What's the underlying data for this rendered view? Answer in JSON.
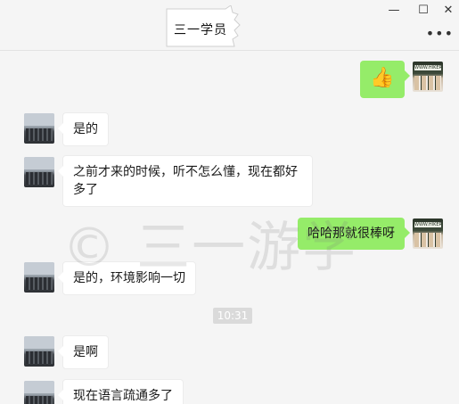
{
  "header": {
    "title": "三一学员",
    "minimize_glyph": "—",
    "maximize_glyph": "☐",
    "close_glyph": "✕",
    "more_glyph": "•••"
  },
  "messages": [
    {
      "side": "right",
      "type": "emoji",
      "icon": "thumbs-up",
      "text": "👍"
    },
    {
      "side": "left",
      "text": "是的"
    },
    {
      "side": "left",
      "text": "之前才来的时候，听不怎么懂，现在都好多了"
    },
    {
      "side": "right",
      "text": "哈哈那就很棒呀"
    },
    {
      "side": "left",
      "text": "是的，环境影响一切"
    },
    {
      "side": "left",
      "text": "是啊"
    },
    {
      "side": "left",
      "text": "现在语言疏通多了"
    }
  ],
  "timestamp": "10:31",
  "watermark": "© 三一游学",
  "my_avatar_sign": "WWW.HIKER",
  "colors": {
    "background": "#f5f5f5",
    "my_bubble": "#95ec69",
    "their_bubble": "#ffffff"
  }
}
